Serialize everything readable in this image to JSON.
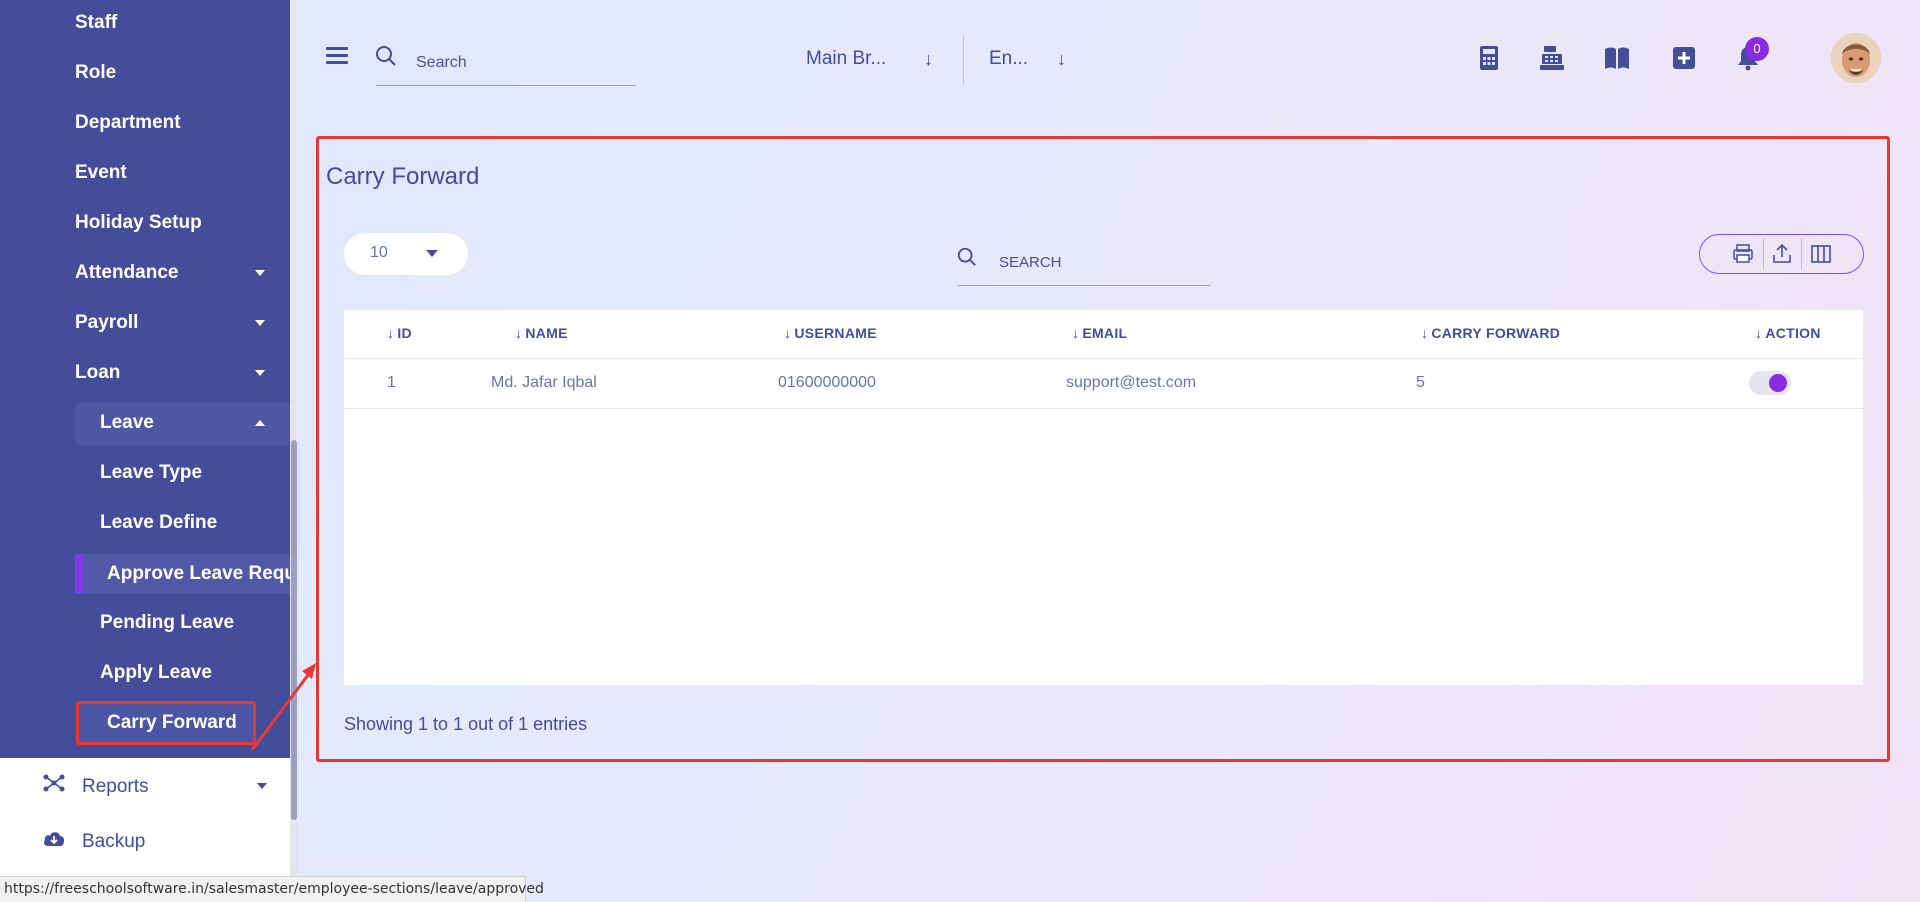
{
  "sidebar": {
    "items": [
      {
        "label": "Staff"
      },
      {
        "label": "Role"
      },
      {
        "label": "Department"
      },
      {
        "label": "Event"
      },
      {
        "label": "Holiday Setup"
      },
      {
        "label": "Attendance"
      },
      {
        "label": "Payroll"
      },
      {
        "label": "Loan"
      },
      {
        "label": "Leave"
      }
    ],
    "leave_sub": [
      {
        "label": "Leave Type"
      },
      {
        "label": "Leave Define"
      },
      {
        "label": "Approve Leave Reque"
      },
      {
        "label": "Pending Leave"
      },
      {
        "label": "Apply Leave"
      },
      {
        "label": "Carry Forward"
      }
    ],
    "lower": [
      {
        "label": "Reports",
        "icon": "reports-icon"
      },
      {
        "label": "Backup",
        "icon": "cloud-download-icon"
      }
    ]
  },
  "header": {
    "search_placeholder": "Search",
    "branch": "Main Br...",
    "language": "En...",
    "notification_count": "0",
    "icons": [
      "calculator-icon",
      "cash-register-icon",
      "book-icon",
      "add-square-icon",
      "bell-icon"
    ]
  },
  "main": {
    "title": "Carry Forward",
    "rows_per_page": "10",
    "search_placeholder": "SEARCH",
    "columns": [
      "ID",
      "NAME",
      "USERNAME",
      "EMAIL",
      "CARRY FORWARD",
      "ACTION"
    ],
    "rows": [
      {
        "id": "1",
        "name": "Md. Jafar Iqbal",
        "username": "01600000000",
        "email": "support@test.com",
        "carry_forward": "5",
        "action_enabled": true
      }
    ],
    "footer": "Showing 1 to 1 out of 1 entries"
  },
  "statusbar": {
    "url": "https://freeschoolsoftware.in/salesmaster/employee-sections/leave/approved"
  },
  "colors": {
    "sidebar": "#434d99",
    "accent": "#8a2be2",
    "highlight": "#e53935"
  }
}
